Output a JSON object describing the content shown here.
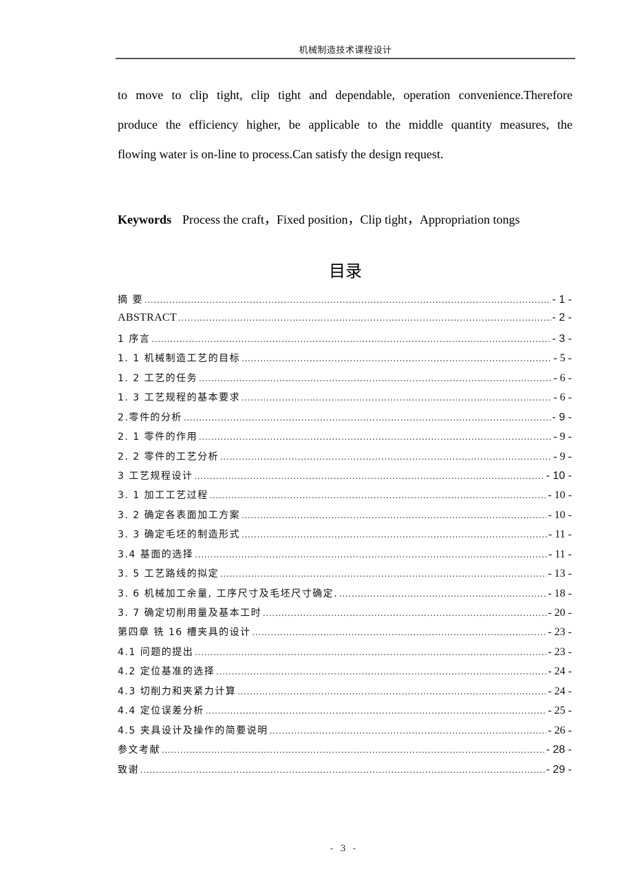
{
  "header": {
    "running_title": "机械制造技术课程设计"
  },
  "abstract": {
    "lines": [
      "to move to clip tight, clip tight and dependable, operation convenience.Therefore",
      "produce the efficiency higher, be applicable to the middle quantity measures, the",
      "flowing water is on-line to process.Can satisfy the design request."
    ]
  },
  "keywords": {
    "label": "Keywords",
    "text": "Process the craft，Fixed position，Clip tight，Appropriation tongs"
  },
  "toc": {
    "title": "目录",
    "entries": [
      {
        "label": "摘  要",
        "page": "- 1 -"
      },
      {
        "label": "ABSTRACT",
        "page": "- 2 -"
      },
      {
        "label": "1 序言",
        "page": "- 3 -"
      },
      {
        "label": "1. 1 机械制造工艺的目标",
        "page": "- 5 -"
      },
      {
        "label": "1. 2 工艺的任务",
        "page": "- 6 -"
      },
      {
        "label": "1. 3 工艺规程的基本要求",
        "page": "- 6 -"
      },
      {
        "label": "2.零件的分析",
        "page": "- 9 -"
      },
      {
        "label": "2. 1 零件的作用",
        "page": "- 9 -"
      },
      {
        "label": "2. 2 零件的工艺分析",
        "page": "- 9 -"
      },
      {
        "label": "3 工艺规程设计",
        "page": "- 10 -"
      },
      {
        "label": "3. 1  加工工艺过程",
        "page": "- 10 -"
      },
      {
        "label": "3. 2 确定各表面加工方案",
        "page": "- 10 -"
      },
      {
        "label": "3. 3 确定毛坯的制造形式",
        "page": "- 11 -"
      },
      {
        "label": "3.4 基面的选择",
        "page": "- 11 -"
      },
      {
        "label": "3. 5 工艺路线的拟定",
        "page": "- 13 -"
      },
      {
        "label": "3. 6 机械加工余量, 工序尺寸及毛坯尺寸确定. ",
        "page": "- 18 -"
      },
      {
        "label": "3. 7 确定切削用量及基本工时",
        "page": "- 20 -"
      },
      {
        "label": "第四章  铣 16 槽夹具的设计",
        "page": "- 23 -"
      },
      {
        "label": "4.1  问题的提出",
        "page": "- 23 -"
      },
      {
        "label": "4.2  定位基准的选择",
        "page": "- 24 -"
      },
      {
        "label": "4.3 切削力和夹紧力计算",
        "page": "- 24 -"
      },
      {
        "label": "4.4 定位误差分析",
        "page": "- 25 -"
      },
      {
        "label": "4.5 夹具设计及操作的简要说明",
        "page": "- 26 -"
      },
      {
        "label": "参文考献",
        "page": "- 28 -"
      },
      {
        "label": "致谢 ",
        "page": "- 29 -"
      }
    ]
  },
  "footer": {
    "page_number": "- 3 -"
  }
}
